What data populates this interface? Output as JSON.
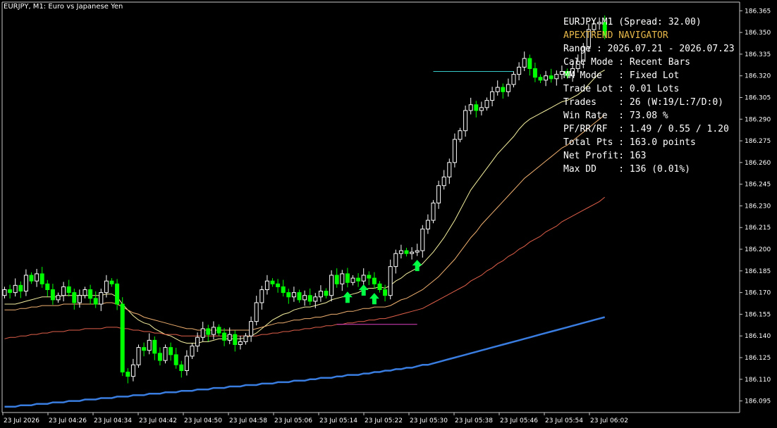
{
  "window": {
    "title": "EURJPY, M1:  Euro vs Japanese Yen"
  },
  "colors": {
    "background": "#000000",
    "axis": "#c8c8c8",
    "bull_candle": "#ffffff",
    "bear_candle": "#00ff00",
    "ma_fast": "#f5f0a0",
    "ma_mid": "#f0b070",
    "ma_slow": "#e0604a",
    "ma_long": "#3a7de0",
    "arrow": "#00ff44",
    "level_cyan": "#35c7c7",
    "level_magenta": "#e040c0",
    "panel_accent": "#e8b84a"
  },
  "info_panel": [
    "EURJPY M1 (Spread: 32.00)",
    "APEXTREND NAVIGATOR",
    "Range : 2026.07.21 - 2026.07.23",
    "Calc Mode : Recent Bars",
    "MM Mode   : Fixed Lot",
    "Trade Lot : 0.01 Lots",
    "Trades    : 26 (W:19/L:7/D:0)",
    "Win Rate  : 73.08 %",
    "PF/RR/RF  : 1.49 / 0.55 / 1.20",
    "Total Pts : 163.0 points",
    "Net Profit: 163",
    "Max DD    : 136 (0.01%)"
  ],
  "chart_data": {
    "type": "candlestick",
    "symbol": "EURJPY",
    "timeframe": "M1",
    "price_axis_labels": [
      "186.365",
      "186.350",
      "186.335",
      "186.320",
      "186.305",
      "186.290",
      "186.275",
      "186.260",
      "186.245",
      "186.230",
      "186.215",
      "186.200",
      "186.185",
      "186.170",
      "186.155",
      "186.140",
      "186.125",
      "186.110",
      "186.095"
    ],
    "time_axis_labels": [
      "23 Jul 2026",
      "23 Jul 04:26",
      "23 Jul 04:34",
      "23 Jul 04:42",
      "23 Jul 04:50",
      "23 Jul 04:58",
      "23 Jul 05:06",
      "23 Jul 05:14",
      "23 Jul 05:22",
      "23 Jul 05:30",
      "23 Jul 05:38",
      "23 Jul 05:46",
      "23 Jul 05:54",
      "23 Jul 06:02"
    ],
    "ylim": [
      186.087,
      186.371
    ],
    "closes": [
      186.172,
      186.17,
      186.175,
      186.171,
      186.182,
      186.178,
      186.183,
      186.176,
      186.172,
      186.165,
      186.168,
      186.174,
      186.17,
      186.163,
      186.168,
      186.172,
      186.166,
      186.162,
      186.17,
      186.178,
      186.176,
      186.162,
      186.115,
      186.112,
      186.12,
      186.132,
      186.13,
      186.137,
      186.128,
      186.123,
      186.132,
      186.127,
      186.12,
      186.116,
      186.126,
      186.133,
      186.139,
      186.145,
      186.141,
      186.146,
      186.142,
      186.137,
      186.141,
      186.134,
      186.136,
      186.14,
      186.15,
      186.163,
      186.172,
      186.178,
      186.176,
      186.174,
      186.17,
      186.167,
      186.17,
      186.165,
      186.168,
      186.164,
      186.167,
      186.171,
      186.168,
      186.182,
      186.176,
      186.183,
      186.177,
      186.18,
      186.178,
      186.182,
      186.18,
      186.176,
      186.172,
      186.168,
      186.188,
      186.197,
      186.199,
      186.197,
      186.198,
      186.199,
      186.214,
      186.22,
      186.232,
      186.244,
      186.25,
      186.26,
      186.276,
      186.282,
      186.296,
      186.3,
      186.296,
      186.298,
      186.303,
      186.309,
      186.312,
      186.309,
      186.314,
      186.321,
      186.326,
      186.332,
      186.325,
      186.319,
      186.317,
      186.32,
      186.318,
      186.321,
      186.323,
      186.32,
      186.325,
      186.33,
      186.34,
      186.352,
      186.356,
      186.357,
      186.348
    ],
    "series": [
      {
        "name": "",
        "values": [
          186.162,
          186.162,
          186.162,
          186.163,
          186.164,
          186.165,
          186.166,
          186.167,
          186.167,
          186.167,
          186.167,
          186.168,
          186.168,
          186.168,
          186.168,
          186.168,
          186.168,
          186.168,
          186.168,
          186.169,
          186.169,
          186.167,
          186.162,
          186.158,
          186.154,
          186.151,
          186.149,
          186.148,
          186.145,
          186.143,
          186.141,
          186.14,
          186.138,
          186.136,
          186.135,
          186.135,
          186.135,
          186.136,
          186.136,
          186.137,
          186.138,
          186.138,
          186.138,
          186.138,
          186.138,
          186.139,
          186.14,
          186.142,
          186.145,
          186.148,
          186.151,
          186.153,
          186.155,
          186.156,
          186.158,
          186.159,
          186.16,
          186.16,
          186.161,
          186.162,
          186.163,
          186.165,
          186.166,
          186.167,
          186.168,
          186.169,
          186.17,
          186.172,
          186.173,
          186.173,
          186.174,
          186.173,
          186.175,
          186.178,
          186.18,
          186.183,
          186.185,
          186.187,
          186.19,
          186.194,
          186.198,
          186.203,
          186.208,
          186.214,
          186.22,
          186.227,
          186.234,
          186.241,
          186.246,
          186.251,
          186.256,
          186.261,
          186.266,
          186.27,
          186.274,
          186.278,
          186.283,
          186.287,
          186.29,
          186.292,
          186.294,
          186.296,
          186.298,
          186.3,
          186.302,
          186.303,
          186.305,
          186.307,
          186.31,
          186.314,
          186.318,
          186.322,
          186.324
        ]
      },
      {
        "name": "",
        "values": [
          186.158,
          186.158,
          186.158,
          186.159,
          186.159,
          186.16,
          186.16,
          186.161,
          186.161,
          186.161,
          186.161,
          186.162,
          186.162,
          186.162,
          186.162,
          186.162,
          186.162,
          186.162,
          186.162,
          186.163,
          186.163,
          186.162,
          186.16,
          186.158,
          186.156,
          186.155,
          186.153,
          186.152,
          186.151,
          186.15,
          186.149,
          186.148,
          186.147,
          186.146,
          186.145,
          186.145,
          186.144,
          186.144,
          186.144,
          186.144,
          186.144,
          186.144,
          186.144,
          186.144,
          186.144,
          186.144,
          186.144,
          186.145,
          186.146,
          186.147,
          186.148,
          186.149,
          186.149,
          186.15,
          186.151,
          186.151,
          186.152,
          186.152,
          186.153,
          186.153,
          186.154,
          186.155,
          186.155,
          186.156,
          186.157,
          186.157,
          186.158,
          186.159,
          186.159,
          186.16,
          186.16,
          186.16,
          186.161,
          186.163,
          186.165,
          186.166,
          186.168,
          186.17,
          186.172,
          186.175,
          186.178,
          186.181,
          186.185,
          186.189,
          186.193,
          186.198,
          186.203,
          186.208,
          186.212,
          186.217,
          186.221,
          186.225,
          186.229,
          186.233,
          186.237,
          186.241,
          186.245,
          186.249,
          186.252,
          186.255,
          186.258,
          186.261,
          186.264,
          186.267,
          186.27,
          186.272,
          186.275,
          186.278,
          186.281,
          186.284,
          186.287,
          186.29,
          186.293
        ]
      },
      {
        "name": "",
        "values": [
          186.138,
          186.139,
          186.139,
          186.14,
          186.14,
          186.141,
          186.141,
          186.142,
          186.142,
          186.143,
          186.143,
          186.143,
          186.144,
          186.144,
          186.144,
          186.145,
          186.145,
          186.145,
          186.145,
          186.146,
          186.146,
          186.146,
          186.145,
          186.145,
          186.144,
          186.144,
          186.143,
          186.143,
          186.142,
          186.142,
          186.141,
          186.141,
          186.141,
          186.14,
          186.14,
          186.14,
          186.14,
          186.14,
          186.14,
          186.14,
          186.14,
          186.14,
          186.14,
          186.14,
          186.14,
          186.14,
          186.14,
          186.14,
          186.141,
          186.141,
          186.142,
          186.142,
          186.143,
          186.143,
          186.144,
          186.144,
          186.145,
          186.145,
          186.146,
          186.146,
          186.147,
          186.147,
          186.148,
          186.148,
          186.149,
          186.149,
          186.15,
          186.15,
          186.151,
          186.151,
          186.152,
          186.152,
          186.153,
          186.154,
          186.155,
          186.156,
          186.157,
          186.158,
          186.159,
          186.161,
          186.163,
          186.165,
          186.167,
          186.169,
          186.171,
          186.173,
          186.175,
          186.178,
          186.18,
          186.182,
          186.185,
          186.187,
          186.19,
          186.192,
          186.195,
          186.197,
          186.2,
          186.202,
          186.205,
          186.207,
          186.209,
          186.212,
          186.214,
          186.216,
          186.219,
          186.221,
          186.223,
          186.225,
          186.227,
          186.229,
          186.231,
          186.233,
          186.236
        ]
      },
      {
        "name": "",
        "values": [
          186.091,
          186.091,
          186.091,
          186.092,
          186.092,
          186.092,
          186.093,
          186.093,
          186.093,
          186.094,
          186.094,
          186.094,
          186.095,
          186.095,
          186.095,
          186.096,
          186.096,
          186.096,
          186.097,
          186.097,
          186.097,
          186.098,
          186.098,
          186.098,
          186.099,
          186.099,
          186.099,
          186.1,
          186.1,
          186.1,
          186.101,
          186.101,
          186.101,
          186.102,
          186.102,
          186.102,
          186.103,
          186.103,
          186.103,
          186.104,
          186.104,
          186.104,
          186.105,
          186.105,
          186.105,
          186.106,
          186.106,
          186.106,
          186.107,
          186.107,
          186.107,
          186.108,
          186.108,
          186.108,
          186.109,
          186.109,
          186.109,
          186.11,
          186.11,
          186.111,
          186.111,
          186.111,
          186.112,
          186.112,
          186.113,
          186.113,
          186.113,
          186.114,
          186.114,
          186.115,
          186.115,
          186.116,
          186.116,
          186.117,
          186.117,
          186.118,
          186.118,
          186.119,
          186.12,
          186.12,
          186.121,
          186.122,
          186.123,
          186.124,
          186.125,
          186.126,
          186.127,
          186.128,
          186.129,
          186.13,
          186.131,
          186.132,
          186.133,
          186.134,
          186.135,
          186.136,
          186.137,
          186.138,
          186.139,
          186.14,
          186.141,
          186.142,
          186.143,
          186.144,
          186.145,
          186.146,
          186.147,
          186.148,
          186.149,
          186.15,
          186.151,
          186.152,
          186.153
        ]
      }
    ],
    "buy_signal_bars": [
      64,
      67,
      69,
      77
    ],
    "levels": [
      {
        "price": 186.323,
        "from_bar": 80,
        "to_bar": 95,
        "color": "cyan"
      },
      {
        "price": 186.148,
        "from_bar": 62,
        "to_bar": 77,
        "color": "magenta"
      }
    ]
  }
}
